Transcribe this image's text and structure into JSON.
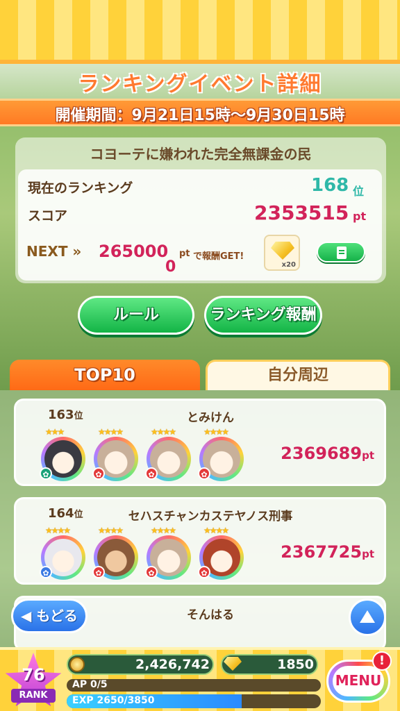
{
  "header": {
    "title": "ランキングイベント詳細",
    "period": "開催期間：9月21日15時〜9月30日15時"
  },
  "player": {
    "name": "コヨーテに嫌われた完全無課金の民",
    "ranking_label": "現在のランキング",
    "ranking_value": "168",
    "ranking_unit": "位",
    "score_label": "スコア",
    "score_value": "2353515",
    "score_unit": "pt",
    "next_label": "NEXT »",
    "next_value": "265000",
    "next_unit": "pt",
    "next_suffix": "で報酬GET!",
    "next_extra": "0",
    "reward_count": "x20"
  },
  "buttons": {
    "rules": "ルール",
    "ranking_reward": "ランキング報酬",
    "back": "もどる",
    "menu": "MENU",
    "menu_badge": "!"
  },
  "tabs": {
    "top10": "TOP10",
    "nearby": "自分周辺"
  },
  "entries": [
    {
      "rank": "163",
      "rank_unit": "位",
      "name": "とみけん",
      "score": "2369689",
      "score_unit": "pt"
    },
    {
      "rank": "164",
      "rank_unit": "位",
      "name": "セハスチャンカステヤノス刑事",
      "score": "2367725",
      "score_unit": "pt"
    },
    {
      "rank": "",
      "rank_unit": "",
      "name": "そんはる",
      "score": "",
      "score_unit": ""
    }
  ],
  "footer": {
    "player_rank": "76",
    "rank_label": "RANK",
    "coins": "2,426,742",
    "gems": "1850",
    "ap": "AP 0/5",
    "exp": "EXP 2650/3850",
    "exp_progress": 0.688
  },
  "colors": {
    "accent_orange": "#ff7a24",
    "score_pink": "#d2235a",
    "rank_teal": "#2fb8a8",
    "button_green": "#13b446"
  }
}
